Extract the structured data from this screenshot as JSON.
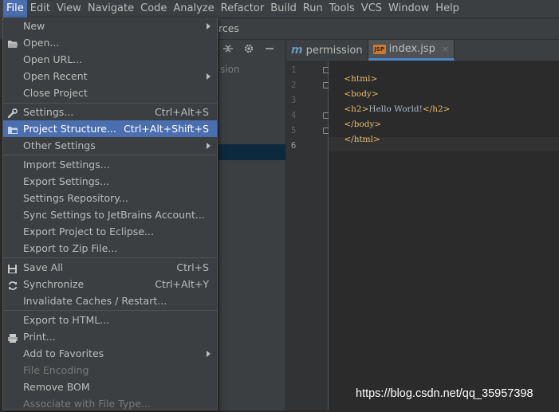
{
  "menubar": {
    "items": [
      "File",
      "Edit",
      "View",
      "Navigate",
      "Code",
      "Analyze",
      "Refactor",
      "Build",
      "Run",
      "Tools",
      "VCS",
      "Window",
      "Help"
    ],
    "active_index": 0
  },
  "breadcrumb_tail": "rces",
  "project_panel": {
    "ghost_text": "sion"
  },
  "editor_tabs": [
    {
      "label": "permission",
      "icon": "m-icon",
      "active": false
    },
    {
      "label": "index.jsp",
      "icon": "jsp-icon",
      "active": true,
      "close": "×"
    }
  ],
  "editor": {
    "line_numbers": [
      "1",
      "2",
      "3",
      "4",
      "5",
      "6"
    ],
    "lines": [
      {
        "open": "<html>",
        "text": "",
        "close": ""
      },
      {
        "open": "<body>",
        "text": "",
        "close": ""
      },
      {
        "open": "<h2>",
        "text": "Hello World!",
        "close": "</h2>"
      },
      {
        "open": "</body>",
        "text": "",
        "close": ""
      },
      {
        "open": "</html>",
        "text": "",
        "close": ""
      },
      {
        "open": "",
        "text": "",
        "close": ""
      }
    ]
  },
  "file_menu": {
    "items": [
      {
        "label": "New",
        "submenu": true
      },
      {
        "label": "Open...",
        "icon": "folder-open-icon"
      },
      {
        "label": "Open URL..."
      },
      {
        "label": "Open Recent",
        "submenu": true
      },
      {
        "label": "Close Project"
      },
      {
        "label": "Settings...",
        "shortcut": "Ctrl+Alt+S",
        "icon": "wrench-icon"
      },
      {
        "label": "Project Structure...",
        "shortcut": "Ctrl+Alt+Shift+S",
        "icon": "project-structure-icon",
        "highlight": true
      },
      {
        "label": "Other Settings",
        "submenu": true
      },
      {
        "label": "Import Settings..."
      },
      {
        "label": "Export Settings..."
      },
      {
        "label": "Settings Repository..."
      },
      {
        "label": "Sync Settings to JetBrains Account..."
      },
      {
        "label": "Export Project to Eclipse..."
      },
      {
        "label": "Export to Zip File..."
      },
      {
        "label": "Save All",
        "shortcut": "Ctrl+S",
        "icon": "save-icon"
      },
      {
        "label": "Synchronize",
        "shortcut": "Ctrl+Alt+Y",
        "icon": "sync-icon"
      },
      {
        "label": "Invalidate Caches / Restart..."
      },
      {
        "label": "Export to HTML..."
      },
      {
        "label": "Print...",
        "icon": "print-icon"
      },
      {
        "label": "Add to Favorites",
        "submenu": true
      },
      {
        "label": "File Encoding",
        "disabled": true
      },
      {
        "label": "Remove BOM"
      },
      {
        "label": "Associate with File Type...",
        "disabled": true
      }
    ]
  },
  "watermark": "https://blog.csdn.net/qq_35957398",
  "colors": {
    "menu_bg": "#3c3f41",
    "highlight": "#4b6eaf",
    "editor_bg": "#2b2b2b",
    "tag": "#e8bf6a",
    "text": "#a9b7c6"
  }
}
